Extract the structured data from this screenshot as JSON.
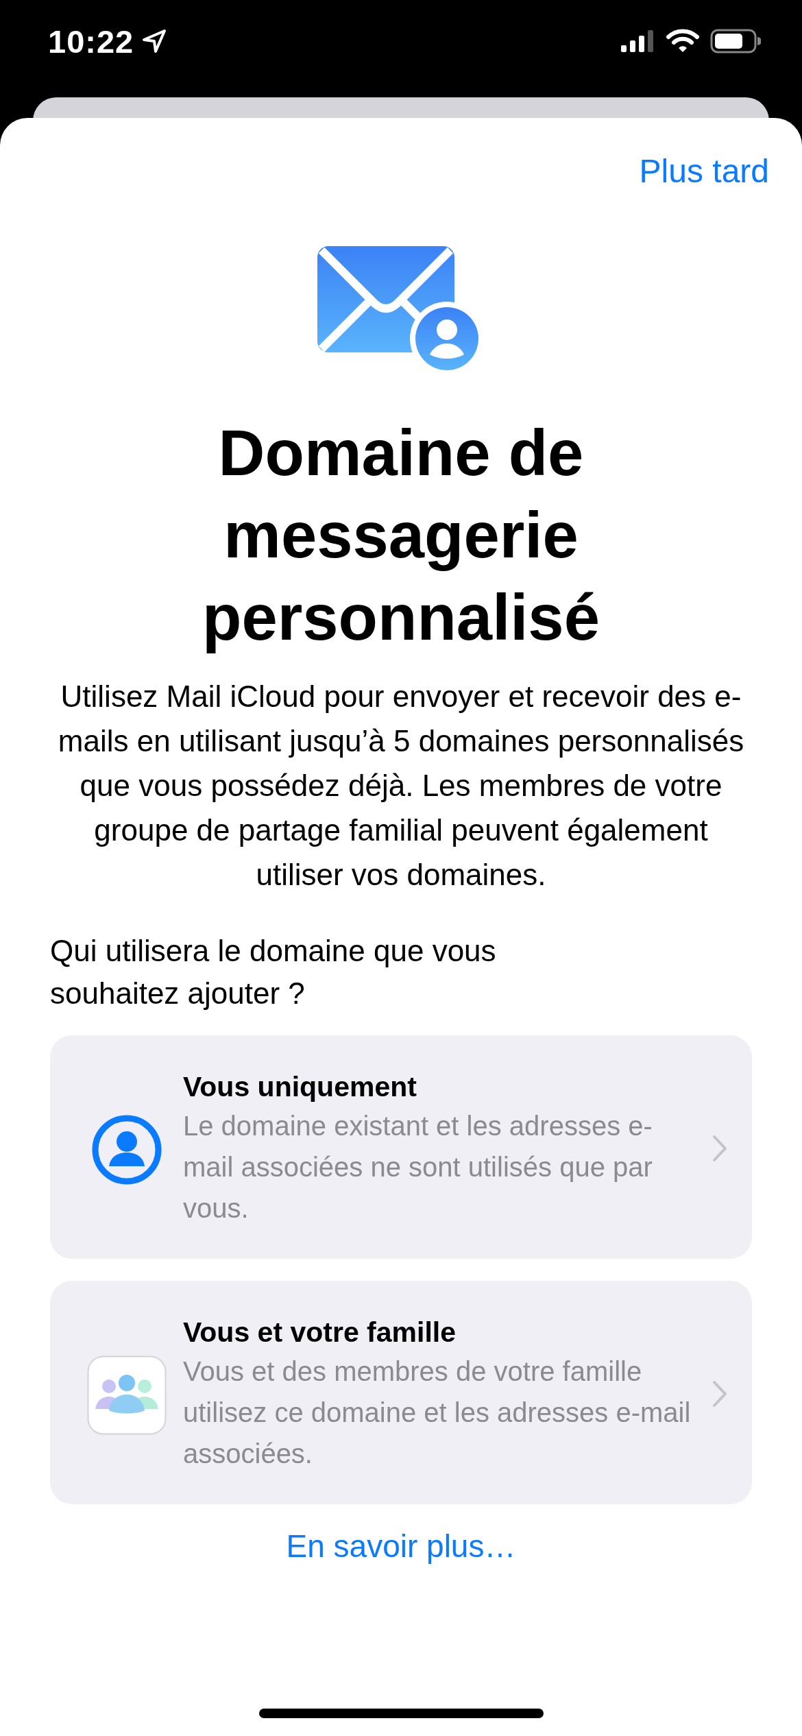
{
  "status_bar": {
    "time": "10:22"
  },
  "header": {
    "later_button": "Plus tard"
  },
  "title": "Domaine de messagerie personnalisé",
  "description": "Utilisez Mail iCloud pour envoyer et recevoir des e-mails en utilisant jusqu’à 5 domaines personnalisés que vous possédez déjà. Les membres de votre groupe de partage familial peuvent également utiliser vos domaines.",
  "question": "Qui utilisera le domaine que vous souhaitez ajouter ?",
  "options": [
    {
      "kind": "person",
      "title": "Vous uniquement",
      "subtitle": "Le domaine existant et les adresses e-mail associées ne sont utilisés que par vous."
    },
    {
      "kind": "family",
      "title": "Vous et votre famille",
      "subtitle": "Vous et des membres de votre famille utilisez ce domaine et les adresses e-mail associées."
    }
  ],
  "learn_more": "En savoir plus…"
}
